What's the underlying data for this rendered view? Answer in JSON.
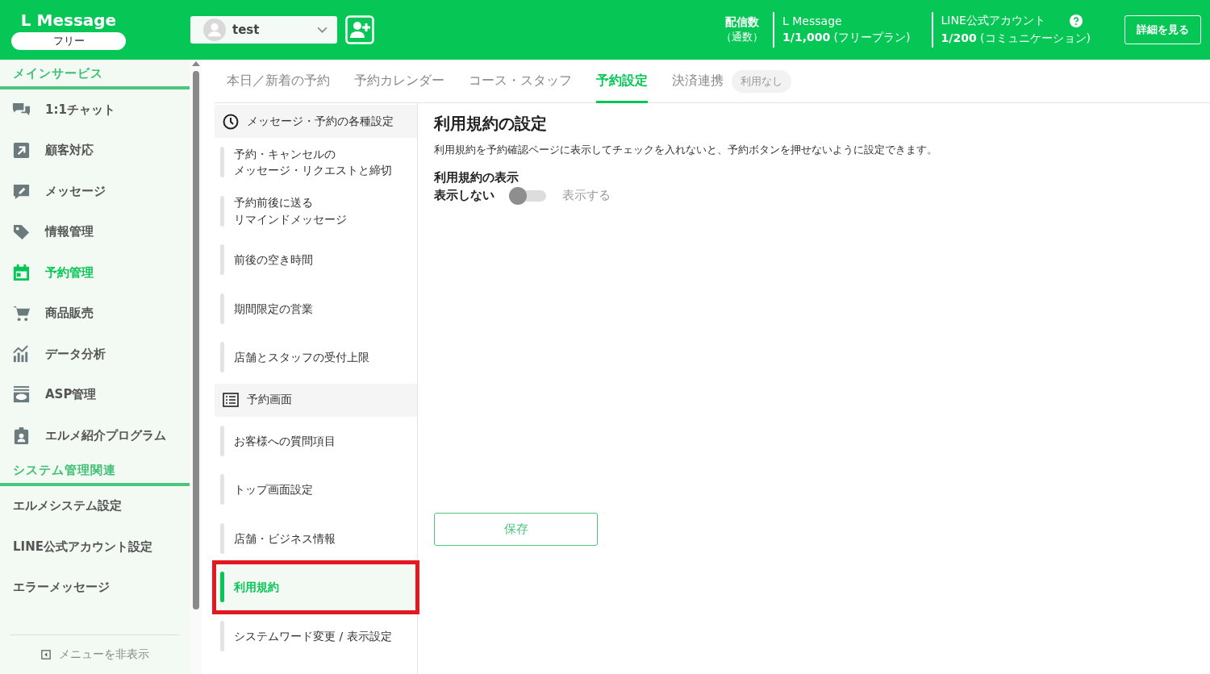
{
  "header": {
    "logo": "L Message",
    "plan": "フリー",
    "account": {
      "name": "test"
    },
    "stats": {
      "label": "配信数",
      "sub": "（通数）"
    },
    "quotas": [
      {
        "title": "L Message",
        "value": "1/1,000",
        "note": "(フリープラン)",
        "help": false
      },
      {
        "title": "LINE公式アカウント",
        "value": "1/200",
        "note": "(コミュニケーション)",
        "help": true
      }
    ],
    "detail_button": "詳細を見る"
  },
  "sidebar": {
    "sections": [
      {
        "title": "メインサービス",
        "items": [
          {
            "label": "1:1チャット",
            "kind": "chat",
            "selected": false
          },
          {
            "label": "顧客対応",
            "kind": "arrow",
            "selected": false
          },
          {
            "label": "メッセージ",
            "kind": "edit",
            "selected": false
          },
          {
            "label": "情報管理",
            "kind": "tag",
            "selected": false
          },
          {
            "label": "予約管理",
            "kind": "calendar",
            "selected": true
          },
          {
            "label": "商品販売",
            "kind": "cart",
            "selected": false
          },
          {
            "label": "データ分析",
            "kind": "chart",
            "selected": false
          },
          {
            "label": "ASP管理",
            "kind": "box",
            "selected": false
          },
          {
            "label": "エルメ紹介プログラム",
            "kind": "badge",
            "selected": false
          }
        ]
      },
      {
        "title": "システム管理関連",
        "items": [
          {
            "label": "エルメシステム設定",
            "selected": false
          },
          {
            "label": "LINE公式アカウント設定",
            "selected": false
          },
          {
            "label": "エラーメッセージ",
            "selected": false
          }
        ]
      }
    ],
    "collapse": "メニューを非表示"
  },
  "tabs": [
    {
      "label": "本日／新着の予約",
      "selected": false
    },
    {
      "label": "予約カレンダー",
      "selected": false
    },
    {
      "label": "コース・スタッフ",
      "selected": false
    },
    {
      "label": "予約設定",
      "selected": true
    },
    {
      "label": "決済連携",
      "selected": false,
      "badge": "利用なし"
    }
  ],
  "settings_nav": [
    {
      "title": "メッセージ・予約の各種設定",
      "kind": "clock",
      "items": [
        {
          "lines": [
            "予約・キャンセルの",
            "メッセージ・リクエストと締切"
          ],
          "selected": false,
          "highlighted": false
        },
        {
          "lines": [
            "予約前後に送る",
            "リマインドメッセージ"
          ],
          "selected": false,
          "highlighted": false
        },
        {
          "lines": [
            "前後の空き時間"
          ],
          "selected": false,
          "highlighted": false
        },
        {
          "lines": [
            "期間限定の営業"
          ],
          "selected": false,
          "highlighted": false
        },
        {
          "lines": [
            "店舗とスタッフの受付上限"
          ],
          "selected": false,
          "highlighted": false
        }
      ]
    },
    {
      "title": "予約画面",
      "kind": "list",
      "items": [
        {
          "lines": [
            "お客様への質問項目"
          ],
          "selected": false,
          "highlighted": false
        },
        {
          "lines": [
            "トップ画面設定"
          ],
          "selected": false,
          "highlighted": false
        },
        {
          "lines": [
            "店舗・ビジネス情報"
          ],
          "selected": false,
          "highlighted": false
        },
        {
          "lines": [
            "利用規約"
          ],
          "selected": true,
          "highlighted": true
        },
        {
          "lines": [
            "システムワード変更 / 表示設定"
          ],
          "selected": false,
          "highlighted": false
        }
      ]
    }
  ],
  "content": {
    "title": "利用規約の設定",
    "description": "利用規約を予約確認ページに表示してチェックを入れないと、予約ボタンを押せないように設定できます。",
    "field_label": "利用規約の表示",
    "toggle": {
      "off_label": "表示しない",
      "on_label": "表示する",
      "on": false
    },
    "save_button": "保存"
  }
}
